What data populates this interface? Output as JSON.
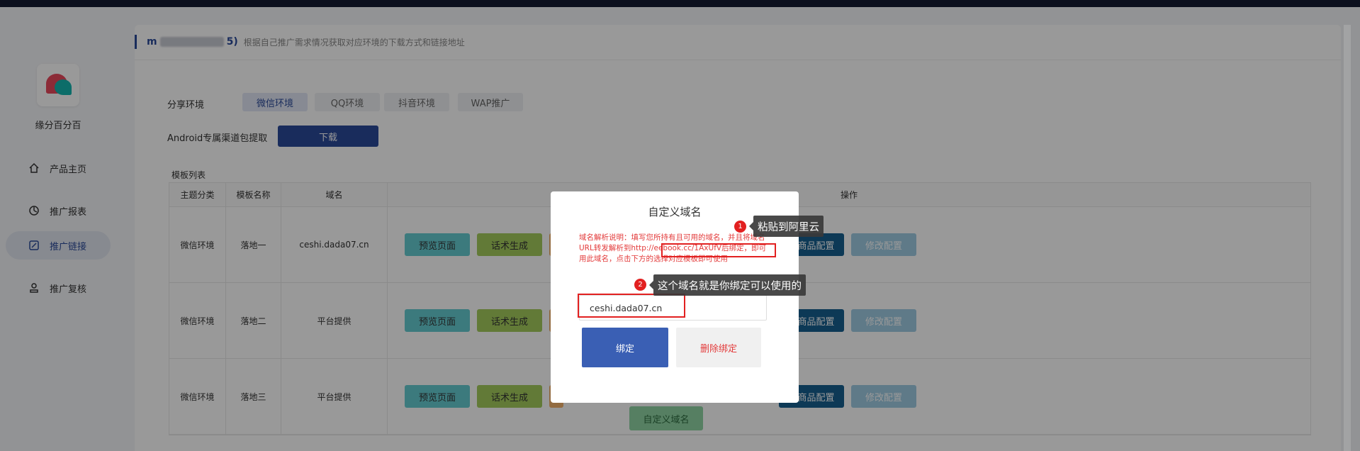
{
  "app": {
    "name": "缘分百分百"
  },
  "sidebar": {
    "items": [
      {
        "label": "产品主页",
        "icon": "home-icon"
      },
      {
        "label": "推广报表",
        "icon": "report-icon"
      },
      {
        "label": "推广链接",
        "icon": "link-icon",
        "active": true
      },
      {
        "label": "推广复核",
        "icon": "review-icon"
      }
    ]
  },
  "header": {
    "title_start": "m",
    "title_end": "5)",
    "description": "根据自己推广需求情况获取对应环境的下载方式和链接地址"
  },
  "share_env": {
    "label": "分享环境",
    "tabs": [
      "微信环境",
      "QQ环境",
      "抖音环境",
      "WAP推广"
    ],
    "active": "微信环境"
  },
  "android": {
    "label": "Android专属渠道包提取",
    "download_label": "下载"
  },
  "template_list": {
    "label": "模板列表",
    "columns": [
      "主题分类",
      "模板名称",
      "域名",
      "操作"
    ],
    "rows": [
      {
        "category": "微信环境",
        "name": "落地一",
        "domain": "ceshi.dada07.cn"
      },
      {
        "category": "微信环境",
        "name": "落地二",
        "domain": "平台提供"
      },
      {
        "category": "微信环境",
        "name": "落地三",
        "domain": "平台提供"
      }
    ],
    "actions": {
      "preview": "预览页面",
      "script": "话术生成",
      "goods": "用商品配置",
      "modify": "修改配置"
    },
    "custom_domain_label": "自定义域名"
  },
  "modal": {
    "title": "自定义域名",
    "note": "域名解析说明：填写您所持有且可用的域名，并且将域名URL转发解析到http://eebook.cc/1AxUfV后绑定，即可用此域名，点击下方的选择对应模板即可使用",
    "input_value": "ceshi.dada07.cn",
    "bind_label": "绑定",
    "unbind_label": "删除绑定"
  },
  "annotations": {
    "tip1": {
      "number": "1",
      "text": "粘贴到阿里云"
    },
    "tip2": {
      "number": "2",
      "text": "这个域名就是你绑定可以使用的"
    }
  },
  "colors": {
    "primary": "#2b4a9a",
    "topbar": "#141b33",
    "warning_red": "#e22020"
  }
}
